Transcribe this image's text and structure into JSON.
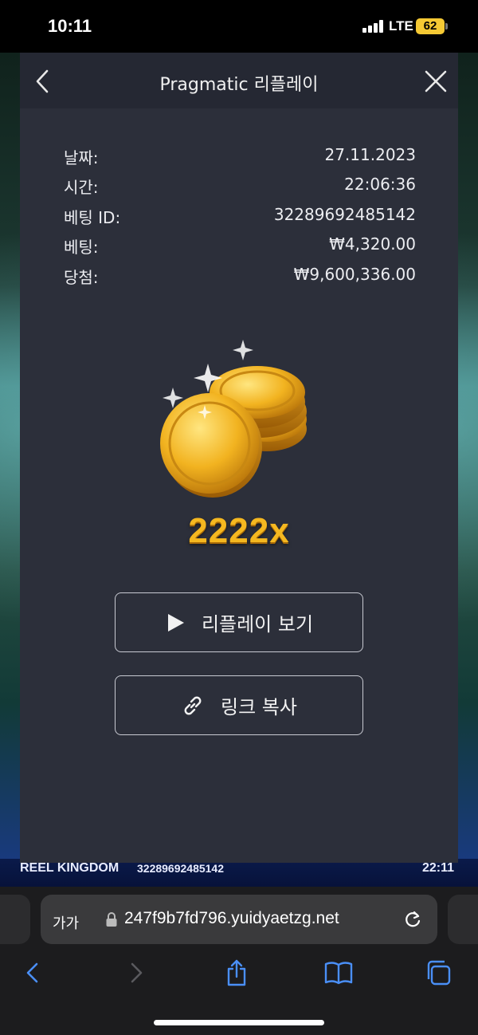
{
  "status_bar": {
    "time": "10:11",
    "network": "LTE",
    "battery": "62"
  },
  "modal": {
    "title": "Pragmatic 리플레이",
    "info": [
      {
        "label": "날짜:",
        "value": "27.11.2023"
      },
      {
        "label": "시간:",
        "value": "22:06:36"
      },
      {
        "label": "베팅 ID:",
        "value": "32289692485142"
      },
      {
        "label": "베팅:",
        "value": "₩4,320.00"
      },
      {
        "label": "당첨:",
        "value": "₩9,600,336.00"
      }
    ],
    "multiplier": "2222x",
    "watch_replay_label": "리플레이 보기",
    "copy_link_label": "링크 복사"
  },
  "game_footer": {
    "brand": "REEL KINGDOM",
    "bet_id": "32289692485142",
    "time": "22:11"
  },
  "browser": {
    "text_size_label": "가가",
    "url": "247f9b7fd796.yuidyaetzg.net"
  },
  "colors": {
    "modal_bg": "#2c2f3a",
    "modal_header_bg": "#252833",
    "multiplier_gold": "#f5b820",
    "safari_accent": "#4a8ff7"
  },
  "icons": {
    "back": "chevron-left-icon",
    "close": "close-icon",
    "play": "play-icon",
    "link": "link-icon",
    "lock": "lock-icon",
    "reload": "reload-icon",
    "share": "share-icon",
    "bookmarks": "book-icon",
    "tabs": "tabs-icon"
  }
}
